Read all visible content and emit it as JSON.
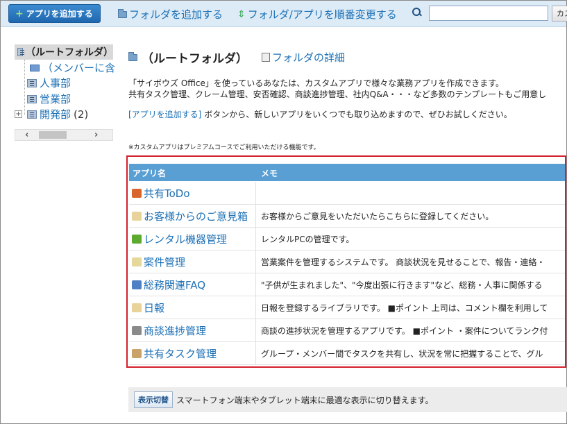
{
  "toolbar": {
    "add_app_label": "アプリを追加する",
    "add_folder_label": "フォルダを追加する",
    "reorder_label": "フォルダ/アプリを順番変更する",
    "search_placeholder": "",
    "search_button_label": "カス"
  },
  "sidebar": {
    "root_label": "（ルートフォルダ）",
    "items": [
      {
        "label": "（メンバーに含"
      },
      {
        "label": "人事部"
      },
      {
        "label": "営業部"
      },
      {
        "label": "開発部",
        "count": "(2)"
      }
    ]
  },
  "main": {
    "title": "（ルートフォルダ）",
    "detail_link": "フォルダの詳細",
    "desc_line1": "「サイボウズ Office」を使っているあなたは、カスタムアプリで様々な業務アプリを作成できます。",
    "desc_line2": "共有タスク管理、クレーム管理、安否確認、商談進捗管理、社内Q&A・・・など多数のテンプレートもご用意し",
    "desc_link": "[アプリを追加する]",
    "desc_line3_rest": "ボタンから、新しいアプリをいくつでも取り込めますので、ぜひお試しください。",
    "note": "※カスタムアプリはプレミアムコースでご利用いただける機能です。"
  },
  "table": {
    "col_name": "アプリ名",
    "col_memo": "メモ",
    "rows": [
      {
        "name": "共有ToDo",
        "memo": "",
        "icon": "stack-icon",
        "color": "#d9642c"
      },
      {
        "name": "お客様からのご意見箱",
        "memo": "お客様からご意見をいただいたらこちらに登録してください。",
        "icon": "note-icon",
        "color": "#e8d49a"
      },
      {
        "name": "レンタル機器管理",
        "memo": "レンタルPCの管理です。",
        "icon": "cube-icon",
        "color": "#5cab2f"
      },
      {
        "name": "案件管理",
        "memo": "営業案件を管理するシステムです。 商談状況を見せることで、報告・連絡・",
        "icon": "folder-icon",
        "color": "#e6d89a"
      },
      {
        "name": "総務関連FAQ",
        "memo": "\"子供が生まれました\"、\"今度出張に行きます\"など、総務・人事に関係する",
        "icon": "database-icon",
        "color": "#4f7fc4"
      },
      {
        "name": "日報",
        "memo": "日報を登録するライブラリです。 ■ポイント 上司は、コメント欄を利用して",
        "icon": "note-icon",
        "color": "#e8d49a"
      },
      {
        "name": "商談進捗管理",
        "memo": "商談の進捗状況を管理するアプリです。 ■ポイント ・案件についてランク付",
        "icon": "binder-icon",
        "color": "#8a8a8a"
      },
      {
        "name": "共有タスク管理",
        "memo": "グループ・メンバー間でタスクを共有し、状況を常に把握することで、グル",
        "icon": "clipboard-icon",
        "color": "#c9a36a"
      }
    ]
  },
  "footer": {
    "switch_button": "表示切替",
    "switch_text": "スマートフォン端末やタブレット端末に最適な表示に切り替えます。"
  }
}
